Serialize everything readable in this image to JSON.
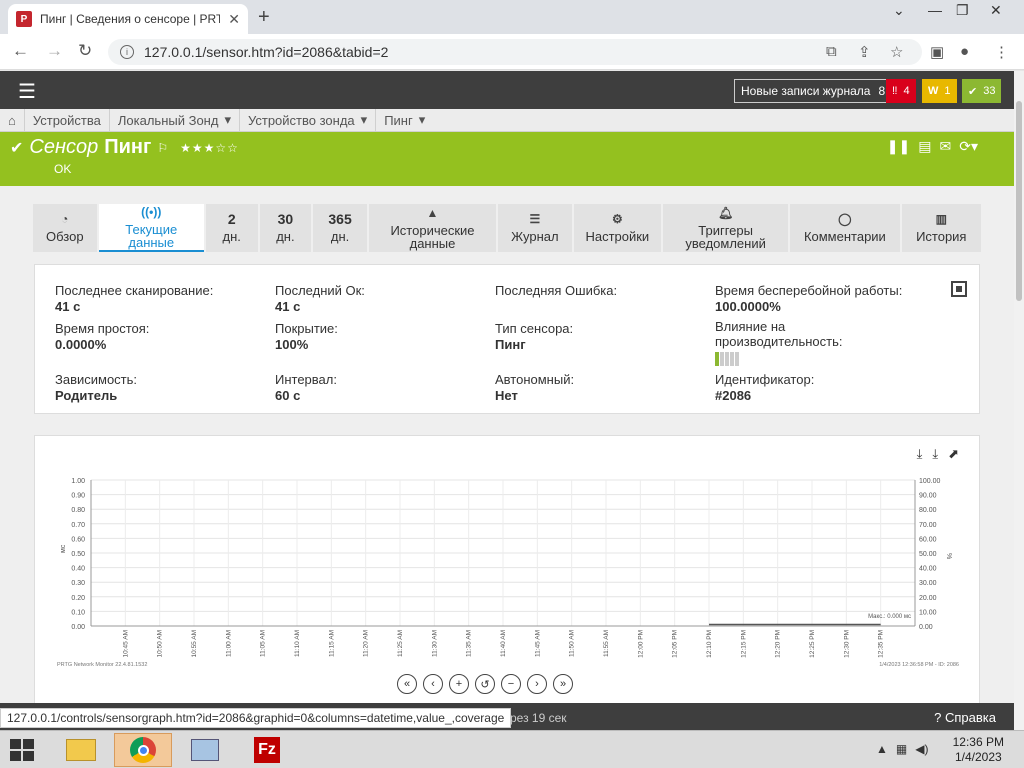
{
  "browser": {
    "tab_title": "Пинг | Сведения о сенсоре | PRTG",
    "favicon_text": "P",
    "url": "127.0.0.1/sensor.htm?id=2086&tabid=2"
  },
  "header": {
    "log_button": "Новые записи журнала",
    "log_count": "8",
    "alarms": "4",
    "warnings": "1",
    "ok_count": "33",
    "colors": {
      "alarm": "#d9001b",
      "warning": "#e8b800",
      "ok": "#8cb832"
    }
  },
  "breadcrumbs": [
    "Устройства",
    "Локальный Зонд",
    "Устройство зонда",
    "Пинг"
  ],
  "sensor": {
    "label": "Сенсор",
    "name": "Пинг",
    "status": "OK",
    "stars": "★★★☆☆",
    "color": "#94c11f"
  },
  "tabs": {
    "overview": "Обзор",
    "live_line1": "Текущие",
    "live_line2": "данные",
    "d2_num": "2",
    "d2_unit": "дн.",
    "d30_num": "30",
    "d30_unit": "дн.",
    "d365_num": "365",
    "d365_unit": "дн.",
    "hist_line1": "Исторические",
    "hist_line2": "данные",
    "log": "Журнал",
    "settings": "Настройки",
    "notif_line1": "Триггеры",
    "notif_line2": "уведомлений",
    "comments": "Комментарии",
    "history": "История"
  },
  "info": {
    "last_scan_label": "Последнее сканирование:",
    "last_scan": "41 с",
    "last_ok_label": "Последний Ок:",
    "last_ok": "41 с",
    "last_error_label": "Последняя Ошибка:",
    "uptime_label": "Время бесперебойной работы:",
    "uptime": "100.0000%",
    "downtime_label": "Время простоя:",
    "downtime": "0.0000%",
    "coverage_label": "Покрытие:",
    "coverage": "100%",
    "type_label": "Тип сенсора:",
    "type": "Пинг",
    "impact_label_1": "Влияние на",
    "impact_label_2": "производительность:",
    "impact_level": 1,
    "dependency_label": "Зависимость:",
    "dependency": "Родитель",
    "interval_label": "Интервал:",
    "interval": "60 с",
    "standalone_label": "Автономный:",
    "standalone": "Нет",
    "id_label": "Идентификатор:",
    "id": "#2086"
  },
  "chart_data": {
    "type": "line",
    "left_axis": {
      "label": "мс",
      "ticks": [
        "1.00",
        "0.90",
        "0.80",
        "0.70",
        "0.60",
        "0.50",
        "0.40",
        "0.30",
        "0.20",
        "0.10",
        "0.00"
      ]
    },
    "right_axis": {
      "label": "%",
      "ticks": [
        "100.00",
        "90.00",
        "80.00",
        "70.00",
        "60.00",
        "50.00",
        "40.00",
        "30.00",
        "20.00",
        "10.00",
        "0.00"
      ]
    },
    "x_ticks": [
      "10:45 AM",
      "10:50 AM",
      "10:55 AM",
      "11:00 AM",
      "11:05 AM",
      "11:10 AM",
      "11:15 AM",
      "11:20 AM",
      "11:25 AM",
      "11:30 AM",
      "11:35 AM",
      "11:40 AM",
      "11:45 AM",
      "11:50 AM",
      "11:55 AM",
      "12:00 PM",
      "12:05 PM",
      "12:10 PM",
      "12:15 PM",
      "12:20 PM",
      "12:25 PM",
      "12:30 PM",
      "12:35 PM"
    ],
    "series": [
      {
        "name": "Макс.",
        "values": [
          0,
          0,
          0,
          0,
          0,
          0,
          0,
          0,
          0,
          0,
          0,
          0,
          0,
          0,
          0,
          0,
          0,
          0,
          0,
          0,
          0,
          0
        ],
        "x_start": "12:10 PM",
        "x_end": "12:35 PM"
      }
    ],
    "legend_text": "Макс.: 0.000 мс",
    "ylim": [
      0,
      1
    ],
    "footer_left": "PRTG Network Monitor 22.4.81.1532",
    "footer_right": "1/4/2023 12:36:58 PM - ID: 2086"
  },
  "footer": {
    "status_link": "127.0.0.1/controls/sensorgraph.htm?id=2086&graphid=0&columns=datetime,value_,coverage",
    "refresh": "рез 19 сек",
    "help": "? Справка"
  },
  "taskbar": {
    "time": "12:36 PM",
    "date": "1/4/2023"
  }
}
